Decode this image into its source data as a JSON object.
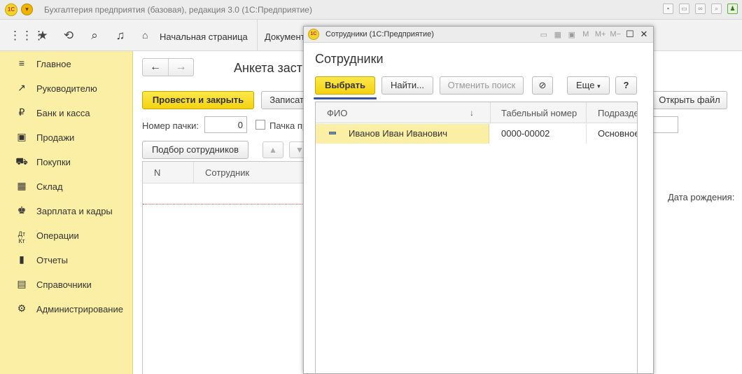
{
  "window": {
    "logo": "1С",
    "title": "Бухгалтерия предприятия (базовая), редакция 3.0  (1С:Предприятие)"
  },
  "topbar": {
    "icons": [
      "apps-grid-icon",
      "star-icon",
      "history-icon",
      "search-icon",
      "bell-icon"
    ],
    "home_tab": "Начальная страница",
    "doc_tab": "Документ"
  },
  "sidebar": {
    "items": [
      {
        "label": "Главное",
        "icon": "menu-icon"
      },
      {
        "label": "Руководителю",
        "icon": "trend-icon"
      },
      {
        "label": "Банк и касса",
        "icon": "ruble-icon"
      },
      {
        "label": "Продажи",
        "icon": "bag-icon"
      },
      {
        "label": "Покупки",
        "icon": "cart-icon"
      },
      {
        "label": "Склад",
        "icon": "warehouse-icon"
      },
      {
        "label": "Зарплата и кадры",
        "icon": "people-icon"
      },
      {
        "label": "Операции",
        "icon": "debit-credit-icon"
      },
      {
        "label": "Отчеты",
        "icon": "bar-chart-icon"
      },
      {
        "label": "Справочники",
        "icon": "books-icon"
      },
      {
        "label": "Администрирование",
        "icon": "gear-icon"
      }
    ]
  },
  "document": {
    "title": "Анкета застрахованного лица",
    "post_close_label": "Провести и закрыть",
    "save_label": "Записать",
    "open_file_label": "Открыть файл",
    "batch_number_label": "Номер пачки:",
    "batch_number_value": "0",
    "batch_checkbox_label": "Пачка принята в ПФР",
    "select_employees_label": "Подбор сотрудников",
    "birth_date_label": "Дата рождения:",
    "grid_columns": [
      "N",
      "Сотрудник"
    ]
  },
  "modal": {
    "window_title": "Сотрудники  (1С:Предприятие)",
    "heading": "Сотрудники",
    "toolbar": {
      "select": "Выбрать",
      "find": "Найти...",
      "cancel_search": "Отменить поиск",
      "more": "Еще",
      "help": "?"
    },
    "tools": {
      "m": "M",
      "m_plus": "M+",
      "m_minus": "M−"
    },
    "grid": {
      "columns": [
        "ФИО",
        "Табельный номер",
        "Подразделение"
      ],
      "rows": [
        {
          "fio": "Иванов Иван Иванович",
          "tab_number": "0000-00002",
          "department": "Основное подразделение"
        }
      ]
    }
  },
  "colors": {
    "sidebar_bg": "#fbeea5",
    "primary_button": "#f3d20f",
    "selection_underline": "#3753a6"
  }
}
